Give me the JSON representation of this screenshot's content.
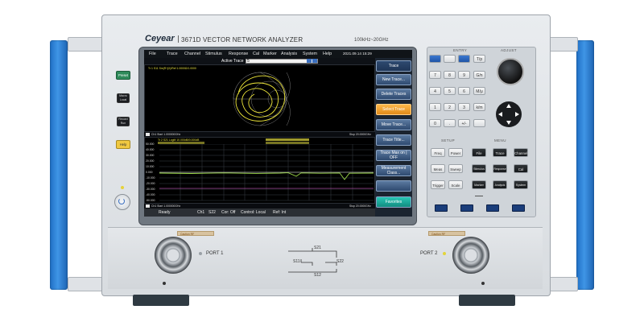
{
  "brand": {
    "logo": "Ceyear",
    "model": "3671D VECTOR NETWORK ANALYZER",
    "freq_range": "100kHz~20GHz"
  },
  "side_keys": [
    "Preset",
    "Macro Local",
    "Record Run",
    "Help"
  ],
  "screen": {
    "menu": [
      "File",
      "Trace",
      "Channel",
      "Stimulus",
      "Response",
      "Cal",
      "Marker",
      "Analysis",
      "System",
      "Help"
    ],
    "datetime": "2021.09.14 15:29",
    "active_trace_label": "Active Trace",
    "active_trace_value": "5",
    "window1": {
      "trace_info": "Tr 1  S11 Sm(R+jX)/Ref 1.0000Ω/1.0000",
      "start_label": "Ch1  Start 1.000000GHz",
      "stop_label": "Stop 20.0000GHz"
    },
    "window2": {
      "trace_info": "Tr 2  S21 LogM 10.000dB/0.000dB",
      "start_label": "Ch1  Start 1.000000GHz",
      "stop_label": "Stop 20.0000GHz",
      "y_ticks": [
        "50.000",
        "40.000",
        "30.000",
        "20.000",
        "10.000",
        "0.000",
        "-10.000",
        "-20.000",
        "-30.000",
        "-40.000",
        "-50.000"
      ]
    },
    "softkeys": [
      "Trace",
      "New Trace...",
      "Delete Traces",
      "Select Trace",
      "Move Trace...",
      "Trace Title...",
      "Trace Max on | OFF",
      "Measurement Class...",
      "",
      "Favorites"
    ],
    "status": {
      "state": "Ready",
      "channel": "Ch1",
      "param": "S22",
      "correction": "Cor: Off",
      "control": "Control: Local",
      "ref": "Ref: Int"
    }
  },
  "keypad": {
    "entry_title": "ENTRY",
    "adjust_title": "ADJUST",
    "setup_title": "SETUP",
    "menu_title": "MENU",
    "numeric": [
      "7",
      "8",
      "9",
      "4",
      "5",
      "6",
      "1",
      "2",
      "3",
      "0",
      ".",
      "+/-"
    ],
    "units": [
      "T/p",
      "G/n",
      "M/μ",
      "k/m"
    ],
    "setup_keys": [
      "Freq",
      "Power",
      "Meas",
      "Sweep",
      "Trigger",
      "Scale"
    ],
    "menu_keys": [
      "File",
      "Trace",
      "Channel",
      "Stimulus",
      "Response",
      "Cal",
      "Marker",
      "Analysis",
      "System"
    ]
  },
  "ports": {
    "port1": "PORT 1",
    "port2": "PORT 2",
    "s21": "S21",
    "s12": "S12",
    "s11": "S11",
    "s22": "S22",
    "warning": "Caution RF"
  }
}
